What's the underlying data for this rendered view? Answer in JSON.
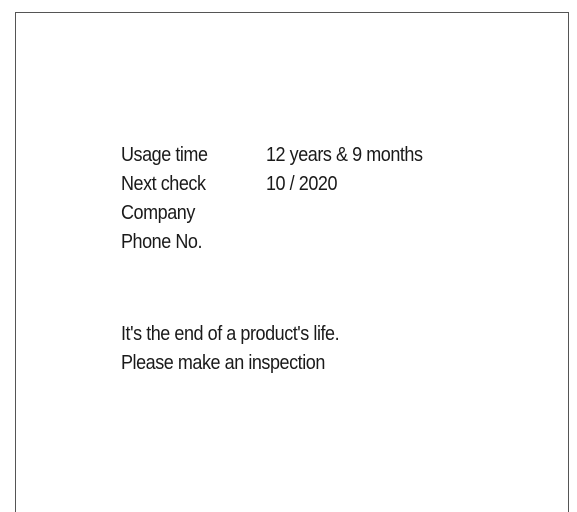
{
  "info": {
    "rows": [
      {
        "label": "Usage time",
        "value": "12 years & 9 months"
      },
      {
        "label": "Next check",
        "value": "10 / 2020"
      },
      {
        "label": "Company",
        "value": ""
      },
      {
        "label": "Phone No.",
        "value": ""
      }
    ]
  },
  "message": {
    "line1": "It's the end of a product's life.",
    "line2": "Please make an inspection"
  }
}
